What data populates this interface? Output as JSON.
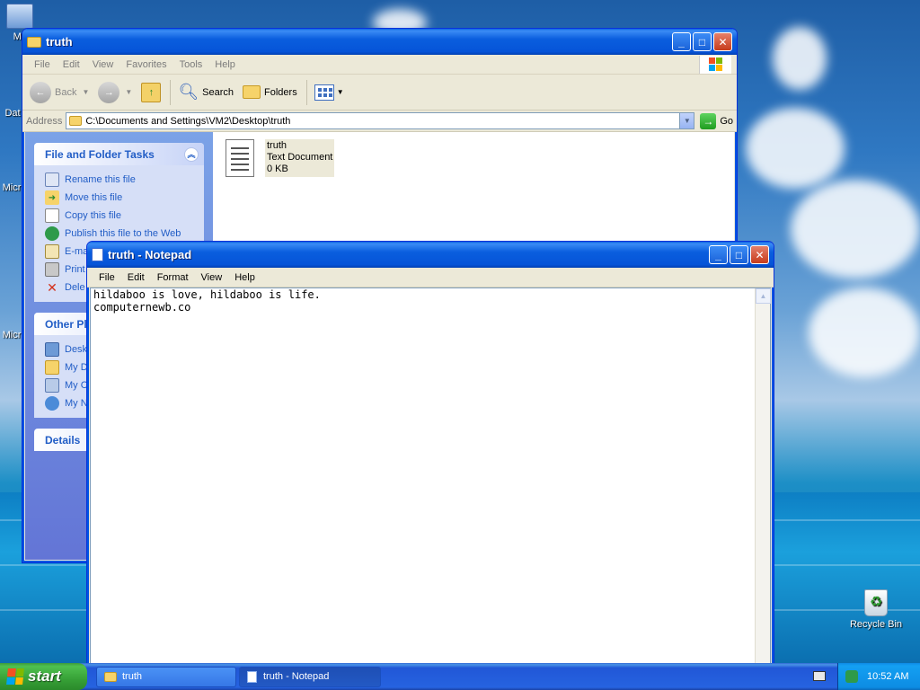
{
  "desktop": {
    "icons": [
      {
        "label": "My"
      },
      {
        "label": "Dat"
      },
      {
        "label": "Micr"
      },
      {
        "label": "Micr"
      },
      {
        "label": "Recycle Bin"
      }
    ]
  },
  "explorer": {
    "title": "truth",
    "menu": [
      "File",
      "Edit",
      "View",
      "Favorites",
      "Tools",
      "Help"
    ],
    "toolbar": {
      "back": "Back",
      "search": "Search",
      "folders": "Folders"
    },
    "address": {
      "label": "Address",
      "value": "C:\\Documents and Settings\\VM2\\Desktop\\truth",
      "go": "Go"
    },
    "tasks": {
      "title": "File and Folder Tasks",
      "items": [
        "Rename this file",
        "Move this file",
        "Copy this file",
        "Publish this file to the Web",
        "E-ma",
        "Print",
        "Dele"
      ]
    },
    "other_places": {
      "title": "Other Pl",
      "items": [
        "Desk",
        "My D",
        "My C",
        "My N"
      ]
    },
    "details": {
      "title": "Details"
    },
    "file": {
      "name": "truth",
      "type": "Text Document",
      "size": "0 KB"
    }
  },
  "notepad": {
    "title": "truth - Notepad",
    "menu": [
      "File",
      "Edit",
      "Format",
      "View",
      "Help"
    ],
    "content": "hildaboo is love, hildaboo is life.\ncomputernewb.co"
  },
  "taskbar": {
    "start": "start",
    "tasks": [
      "truth",
      "truth - Notepad"
    ],
    "clock": "10:52 AM"
  },
  "colors": {
    "titlebar": "#0a5ede",
    "taskbar": "#2663e0",
    "start": "#37a137",
    "link": "#215dc6"
  }
}
